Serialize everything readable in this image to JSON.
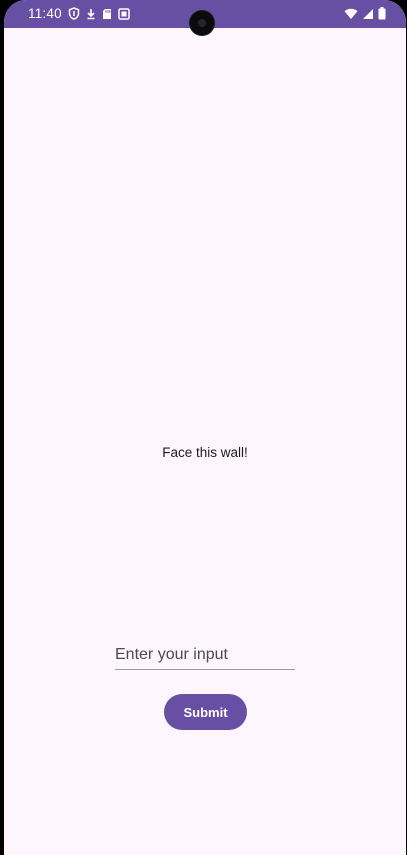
{
  "status_bar": {
    "time": "11:40",
    "left_icons": [
      "shield-icon",
      "download-icon",
      "sd-card-icon",
      "screenshot-icon"
    ],
    "right_icons": [
      "wifi-icon",
      "signal-icon",
      "battery-icon"
    ],
    "background_color": "#6750a4"
  },
  "main": {
    "label": "Face this wall!",
    "input": {
      "placeholder": "Enter your input",
      "value": ""
    },
    "submit_label": "Submit"
  },
  "colors": {
    "accent": "#6750a4",
    "surface": "#fdf7fd",
    "text": "#1d1b20"
  }
}
